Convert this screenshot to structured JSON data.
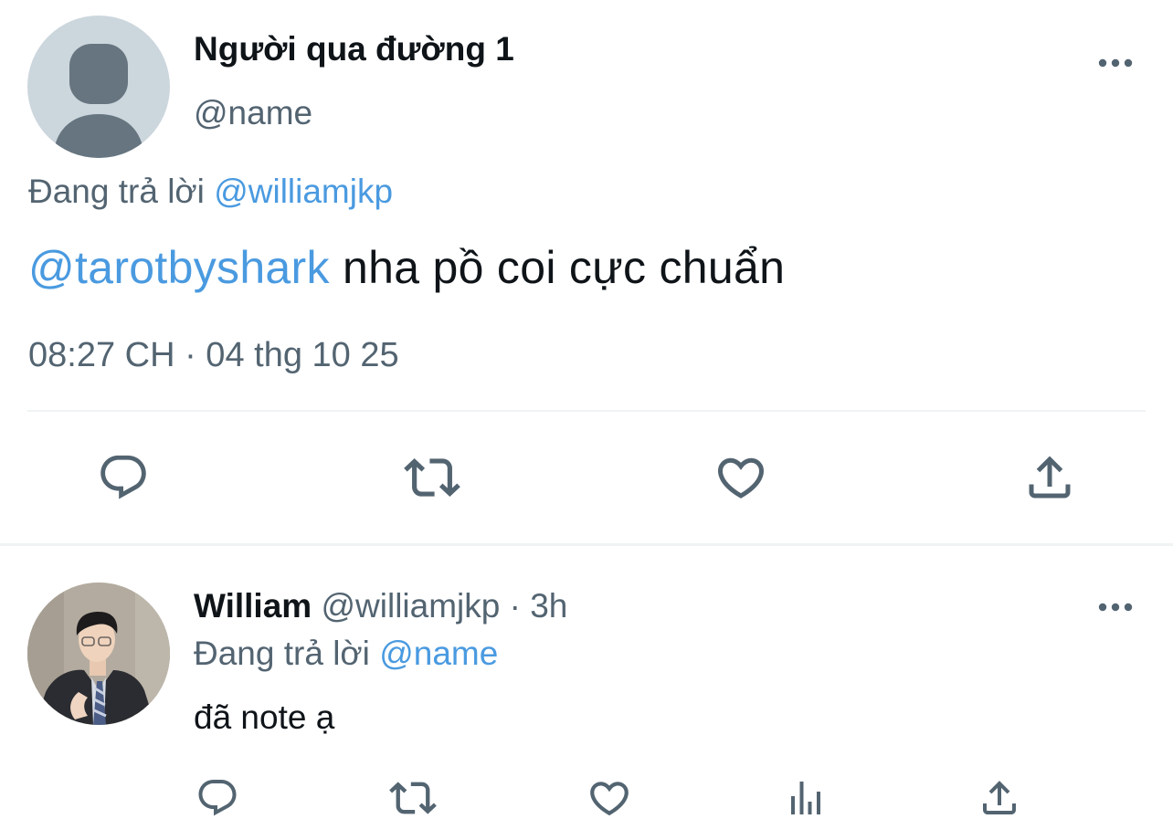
{
  "main_tweet": {
    "display_name": "Người qua đường 1",
    "handle": "@name",
    "replying_prefix": "Đang trả lời",
    "replying_to": "@williamjkp",
    "mention": "@tarotbyshark",
    "text": "nha pồ coi cực chuẩn",
    "timestamp": "08:27 CH · 04 thg 10 25",
    "actions": [
      "reply-icon",
      "retweet-icon",
      "like-icon",
      "share-icon"
    ]
  },
  "reply_tweet": {
    "display_name": "William",
    "handle_meta": "@williamjkp · 3h",
    "replying_prefix": "Đang trả lời",
    "replying_to": "@name",
    "text": "đã note ạ",
    "actions": [
      "reply-icon",
      "retweet-icon",
      "like-icon",
      "views-icon",
      "share-icon"
    ]
  },
  "colors": {
    "link": "#4a9ae0",
    "secondary_text": "#536471",
    "primary_text": "#0f1419",
    "divider": "#eff3f4"
  }
}
